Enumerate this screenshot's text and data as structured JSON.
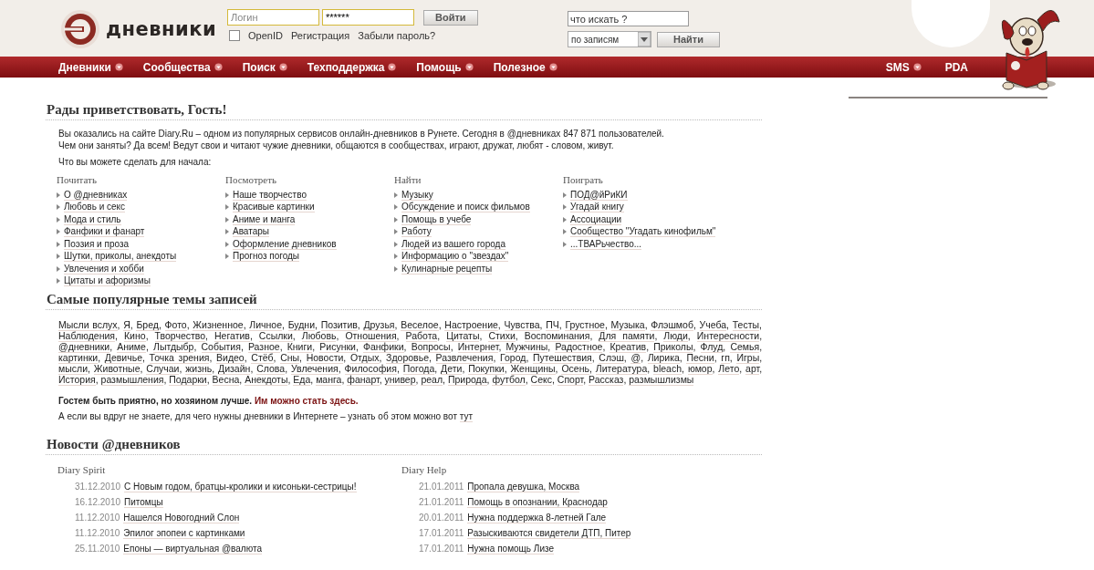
{
  "header": {
    "logo_text": "дневники",
    "login": {
      "login_placeholder": "Логин",
      "password_value": "******",
      "submit": "Войти",
      "openid_checked": false,
      "openid_label": "OpenID",
      "links": [
        "Регистрация",
        "Забыли пароль?"
      ]
    },
    "search": {
      "placeholder": "что искать ?",
      "scope": "по записям",
      "submit": "Найти"
    }
  },
  "nav": {
    "left": [
      {
        "label": "Дневники",
        "dropdown": true
      },
      {
        "label": "Сообщества",
        "dropdown": true
      },
      {
        "label": "Поиск",
        "dropdown": true
      },
      {
        "label": "Техподдержка",
        "dropdown": true
      },
      {
        "label": "Помощь",
        "dropdown": true
      },
      {
        "label": "Полезное",
        "dropdown": true
      }
    ],
    "right": [
      {
        "label": "SMS",
        "dropdown": true
      },
      {
        "label": "PDA",
        "dropdown": false
      }
    ]
  },
  "welcome": {
    "title": "Рады приветствовать, Гость!",
    "intro": [
      "Вы оказались на сайте Diary.Ru – одном из популярных сервисов онлайн-дневников в Рунете. Сегодня в @дневниках 847 871 пользователей.",
      "Чем они заняты? Да всем! Ведут свои и читают чужие дневники, общаются в сообществах, играют, дружат, любят - словом, живут."
    ],
    "prompt": "Что вы можете сделать для начала:",
    "columns": [
      {
        "heading": "Почитать",
        "links": [
          "О @дневниках",
          "Любовь и секс",
          "Мода и стиль",
          "Фанфики и фанарт",
          "Поэзия и проза",
          "Шутки, приколы, анекдоты",
          "Увлечения и хобби",
          "Цитаты и афоризмы"
        ]
      },
      {
        "heading": "Посмотреть",
        "links": [
          "Наше творчество",
          "Красивые картинки",
          "Аниме и манга",
          "Аватары",
          "Оформление дневников",
          "Прогноз погоды"
        ]
      },
      {
        "heading": "Найти",
        "links": [
          "Музыку",
          "Обсуждение и поиск фильмов",
          "Помощь в учебе",
          "Работу",
          "Людей из вашего города",
          "Информацию о \"звездах\"",
          "Кулинарные рецепты"
        ]
      },
      {
        "heading": "Поиграть",
        "links": [
          "ПОД@йРиКИ",
          "Угадай книгу",
          "Ассоциации",
          "Сообщество \"Угадать кинофильм\"",
          "...ТВАРьчество..."
        ]
      }
    ]
  },
  "topics": {
    "title": "Самые популярные темы записей",
    "separator": ",",
    "tags": [
      "Мысли вслух",
      "Я",
      "Бред",
      "Фото",
      "Жизненное",
      "Личное",
      "Будни",
      "Позитив",
      "Друзья",
      "Веселое",
      "Настроение",
      "Чувства",
      "ПЧ",
      "Грустное",
      "Музыка",
      "Флэшмоб",
      "Учеба",
      "Тесты",
      "Наблюдения",
      "Кино",
      "Творчество",
      "Негатив",
      "Ссылки",
      "Любовь",
      "Отношения",
      "Работа",
      "Цитаты",
      "Стихи",
      "Воспоминания",
      "Для памяти",
      "Люди",
      "Интересности",
      "@дневники",
      "Аниме",
      "Лытдыбр",
      "События",
      "Разное",
      "Книги",
      "Рисунки",
      "Фанфики",
      "Вопросы",
      "Интернет",
      "Мужчины",
      "Радостное",
      "Креатив",
      "Приколы",
      "Флуд",
      "Семья",
      "картинки",
      "Девичье",
      "Точка зрения",
      "Видео",
      "Стёб",
      "Сны",
      "Новости",
      "Отдых",
      "Здоровье",
      "Развлечения",
      "Город",
      "Путешествия",
      "Слэш",
      "@",
      "Лирика",
      "Песни",
      "гп",
      "Игры",
      "мысли",
      "Животные",
      "Случаи",
      "жизнь",
      "Дизайн",
      "Слова",
      "Увлечения",
      "Философия",
      "Погода",
      "Дети",
      "Покупки",
      "Женщины",
      "Осень",
      "Литература",
      "bleach",
      "юмор",
      "Лето",
      "арт",
      "История",
      "размышления",
      "Подарки",
      "Весна",
      "Анекдоты",
      "Еда",
      "манга",
      "фанарт",
      "универ",
      "реал",
      "Природа",
      "футбол",
      "Секс",
      "Спорт",
      "Рассказ",
      "размышлизмы"
    ],
    "guest_text": "Гостем быть приятно, но хозяином лучше. ",
    "guest_link": "Им можно стать здесь.",
    "help_text": "А если вы вдруг не знаете, для чего нужны дневники в Интернете – узнать об этом можно вот ",
    "help_link": "тут"
  },
  "news": {
    "title": "Новости @дневников",
    "columns": [
      {
        "heading": "Diary Spirit",
        "items": [
          {
            "date": "31.12.2010",
            "title": "С Новым годом, братцы-кролики и кисоньки-сестрицы!"
          },
          {
            "date": "16.12.2010",
            "title": "Питомцы"
          },
          {
            "date": "11.12.2010",
            "title": "Нашелся Новогодний Слон"
          },
          {
            "date": "11.12.2010",
            "title": "Эпилог эпопеи с картинками"
          },
          {
            "date": "25.11.2010",
            "title": "Епоны — виртуальная @валюта"
          }
        ]
      },
      {
        "heading": "Diary Help",
        "items": [
          {
            "date": "21.01.2011",
            "title": "Пропала девушка, Москва"
          },
          {
            "date": "21.01.2011",
            "title": "Помощь в опознании, Краснодар"
          },
          {
            "date": "20.01.2011",
            "title": "Нужна поддержка 8-летней Гале"
          },
          {
            "date": "17.01.2011",
            "title": "Разыскиваются свидетели ДТП, Питер"
          },
          {
            "date": "17.01.2011",
            "title": "Нужна помощь Лизе"
          }
        ]
      }
    ]
  }
}
